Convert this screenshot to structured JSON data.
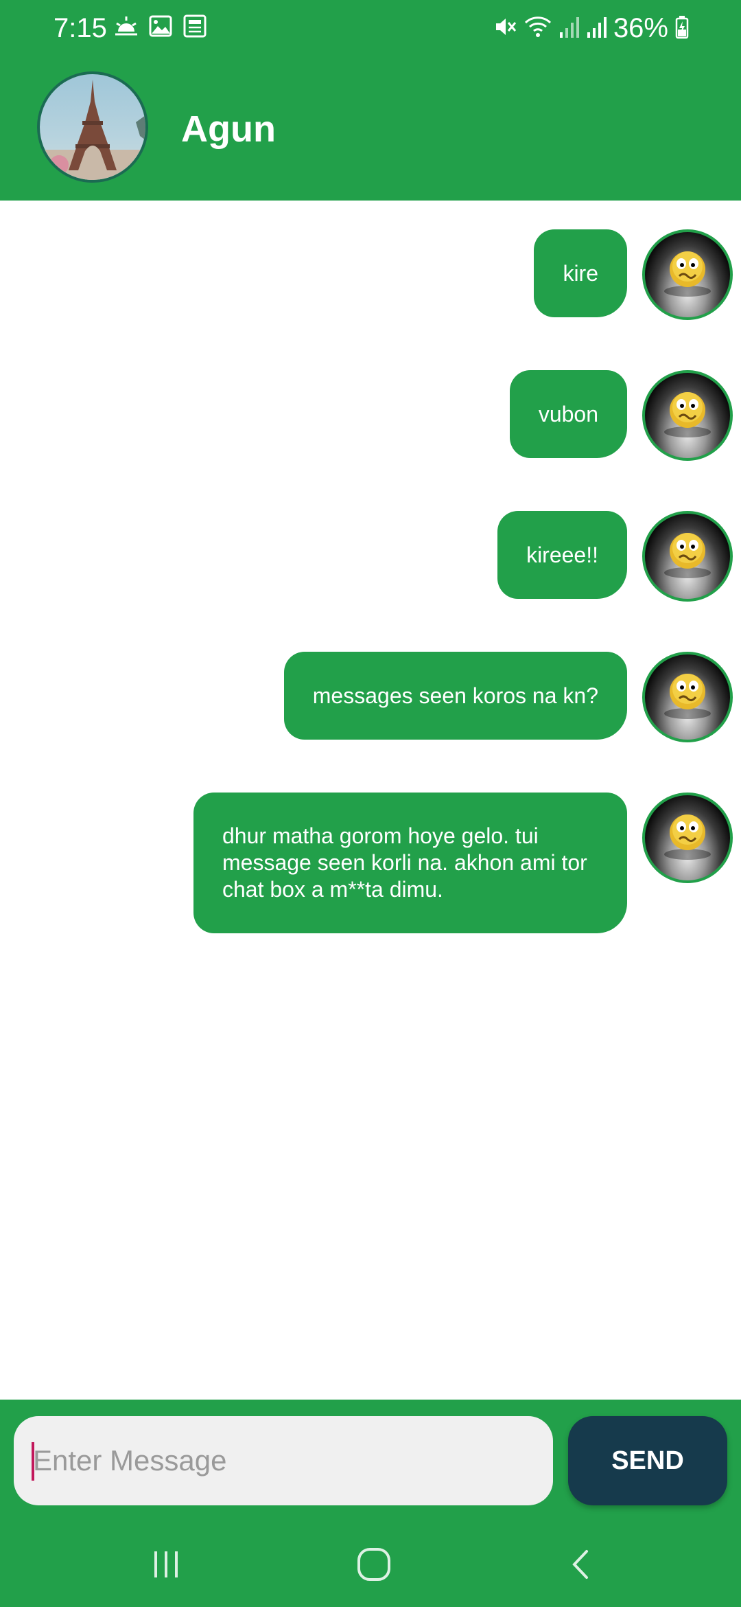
{
  "status_bar": {
    "time": "7:15",
    "battery_percent": "36%",
    "left_icons": [
      "weather-sunrise-icon",
      "image-icon",
      "news-icon"
    ],
    "right_icons": [
      "mute-icon",
      "wifi-icon",
      "signal-icon",
      "signal-icon",
      "battery-charging-icon"
    ]
  },
  "header": {
    "contact_name": "Agun",
    "avatar": "eiffel-tower-photo"
  },
  "messages": [
    {
      "text": "kire",
      "sender": "me"
    },
    {
      "text": "vubon",
      "sender": "me"
    },
    {
      "text": "kireee!!",
      "sender": "me"
    },
    {
      "text": "messages seen koros na kn?",
      "sender": "me"
    },
    {
      "text": "dhur matha gorom hoye gelo. tui message seen korli na. akhon ami tor chat box a m**ta dimu.",
      "sender": "me"
    }
  ],
  "composer": {
    "placeholder": "Enter Message",
    "value": "",
    "send_label": "SEND"
  },
  "navigation": {
    "buttons": [
      "recent-apps-icon",
      "home-icon",
      "back-icon"
    ]
  },
  "colors": {
    "primary": "#22a04a",
    "send_button": "#163a4c",
    "input_bg": "#f0f0f0",
    "caret": "#c2185b"
  }
}
